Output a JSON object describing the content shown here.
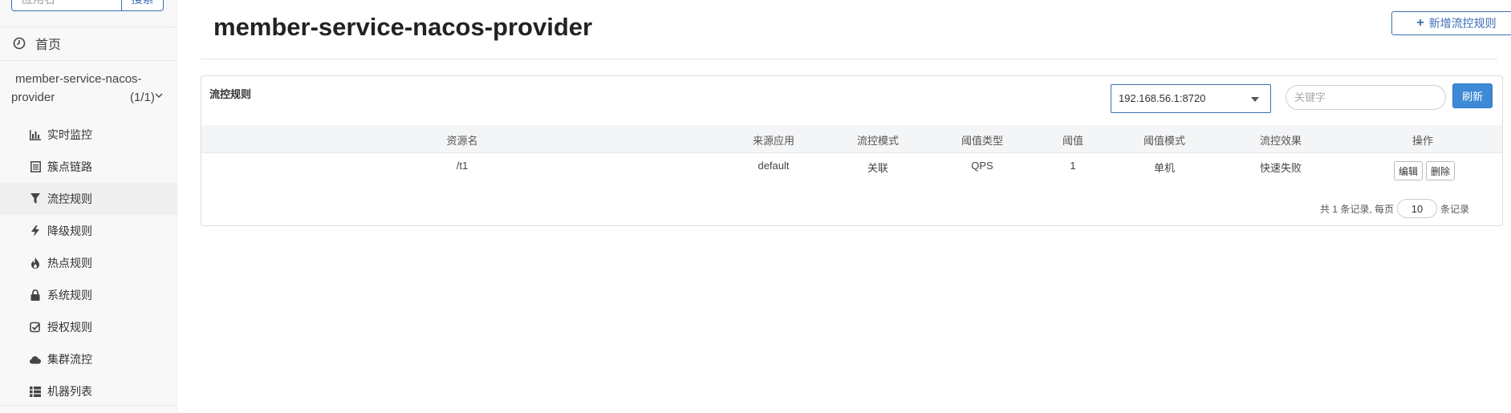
{
  "sidebar": {
    "search": {
      "placeholder": "应用名",
      "button": "搜索"
    },
    "home": {
      "label": "首页",
      "icon": "dashboard-icon"
    },
    "app": {
      "name_line1": "member-service-nacos-",
      "name_line2": "provider",
      "count": "(1/1)"
    },
    "items": [
      {
        "label": "实时监控",
        "icon": "bar-chart-icon"
      },
      {
        "label": "簇点链路",
        "icon": "list-icon"
      },
      {
        "label": "流控规则",
        "icon": "filter-icon",
        "active": true
      },
      {
        "label": "降级规则",
        "icon": "flash-icon"
      },
      {
        "label": "热点规则",
        "icon": "fire-icon"
      },
      {
        "label": "系统规则",
        "icon": "lock-icon"
      },
      {
        "label": "授权规则",
        "icon": "check-square-icon"
      },
      {
        "label": "集群流控",
        "icon": "cloud-icon"
      },
      {
        "label": "机器列表",
        "icon": "th-list-icon"
      }
    ]
  },
  "header": {
    "title": "member-service-nacos-provider",
    "add_button": "新增流控规则"
  },
  "panel": {
    "title": "流控规则",
    "machine_select": "192.168.56.1:8720",
    "keyword_placeholder": "关键字",
    "refresh_button": "刷新"
  },
  "table": {
    "columns": [
      "资源名",
      "来源应用",
      "流控模式",
      "阈值类型",
      "阈值",
      "阈值模式",
      "流控效果",
      "操作"
    ],
    "rows": [
      {
        "resource": "/t1",
        "limit_app": "default",
        "strategy": "关联",
        "grade": "QPS",
        "count": "1",
        "cluster_mode": "单机",
        "control_behavior": "快速失败",
        "edit": "编辑",
        "delete": "删除"
      }
    ]
  },
  "pagination": {
    "prefix": "共 1 条记录, 每页",
    "page_size": "10",
    "suffix": "条记录"
  },
  "colors": {
    "primary": "#3c6eb5",
    "refresh_bg": "#3d8ad6",
    "sidebar_bg": "#f8f8f8",
    "active_item_bg": "#efefef"
  }
}
